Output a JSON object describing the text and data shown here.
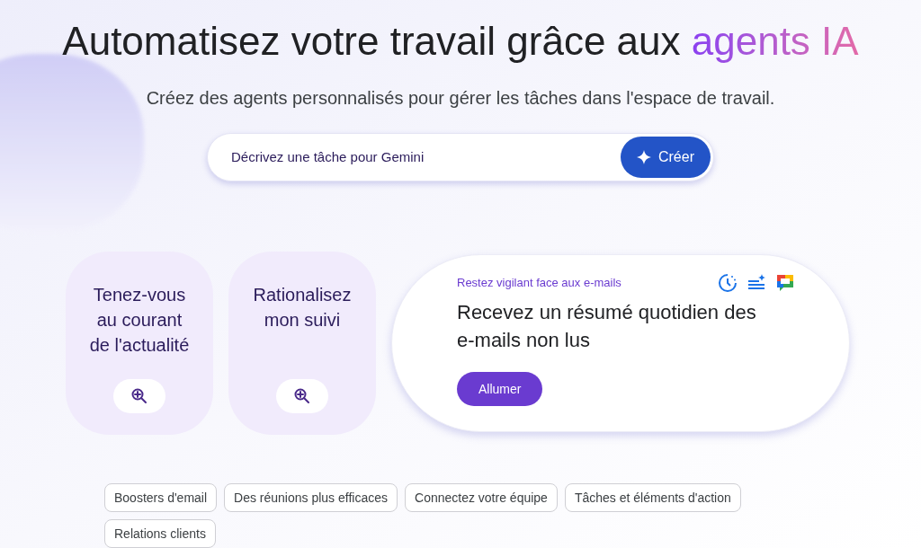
{
  "headline": {
    "text": "Automatisez votre travail grâce aux",
    "highlight": "agents IA"
  },
  "subtitle": "Créez des agents personnalisés pour gérer les tâches dans l'espace de travail.",
  "prompt": {
    "placeholder": "Décrivez une tâche pour Gemini",
    "button": "Créer"
  },
  "cards": [
    {
      "kind": "compact",
      "title": "Tenez-vous au courant de l'actualité"
    },
    {
      "kind": "compact",
      "title": "Rationalisez mon suivi"
    },
    {
      "kind": "featured",
      "eyebrow": "Restez vigilant face aux e-mails",
      "title": "Recevez un résumé quotidien des e-mails non lus",
      "button": "Allumer"
    }
  ],
  "chips": [
    {
      "label": "Boosters d'email",
      "selected": false
    },
    {
      "label": "Des réunions plus efficaces",
      "selected": false
    },
    {
      "label": "Connectez votre équipe",
      "selected": false
    },
    {
      "label": "Tâches et éléments d'action",
      "selected": false
    },
    {
      "label": "Relations clients",
      "selected": false
    }
  ]
}
